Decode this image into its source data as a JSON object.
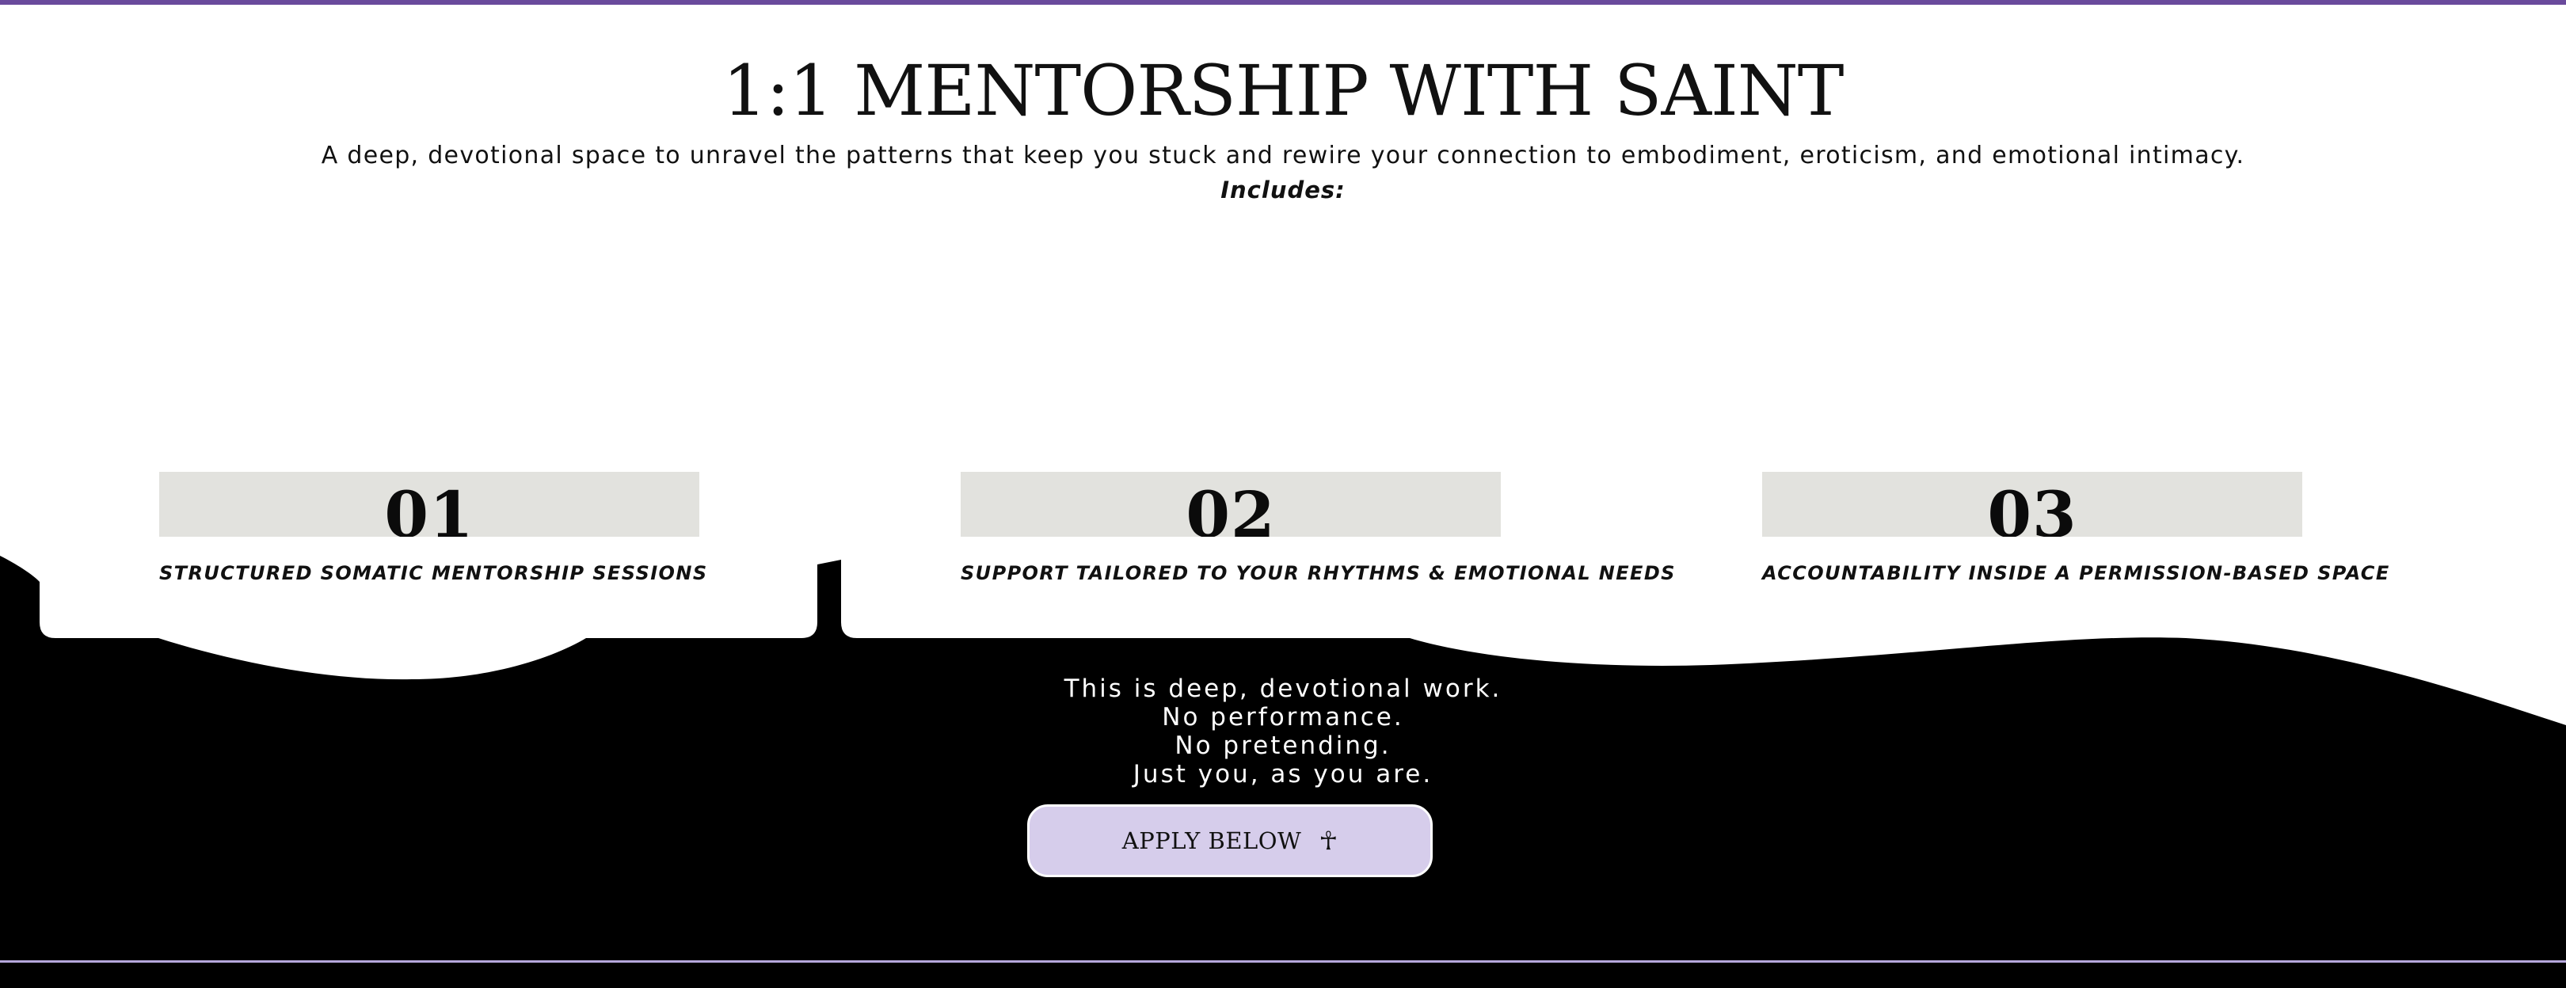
{
  "header": {
    "title": "1:1 MENTORSHIP WITH SAINT",
    "subtitle": "A deep, devotional space to unravel the patterns that keep you stuck and rewire your connection to embodiment, eroticism, and emotional intimacy.",
    "includes_label": "Includes:"
  },
  "cards": [
    {
      "number": "01",
      "label": "STRUCTURED SOMATIC MENTORSHIP SESSIONS"
    },
    {
      "number": "02",
      "label": "SUPPORT TAILORED TO YOUR RHYTHMS & EMOTIONAL NEEDS"
    },
    {
      "number": "03",
      "label": "ACCOUNTABILITY INSIDE A PERMISSION-BASED SPACE"
    }
  ],
  "closing": {
    "line1": "This is deep, devotional work.",
    "line2": "No performance.",
    "line3": "No pretending.",
    "line4": "Just you, as you are."
  },
  "cta": {
    "label": "APPLY BELOW",
    "icon": "ankh-icon",
    "icon_glyph": "☥"
  },
  "colors": {
    "accent_purple": "#6a4a9c",
    "button_lavender": "#d6cdeb",
    "card_grey": "#e2e2de",
    "footer_line": "#b5a7db",
    "dark_bg": "#000000"
  }
}
